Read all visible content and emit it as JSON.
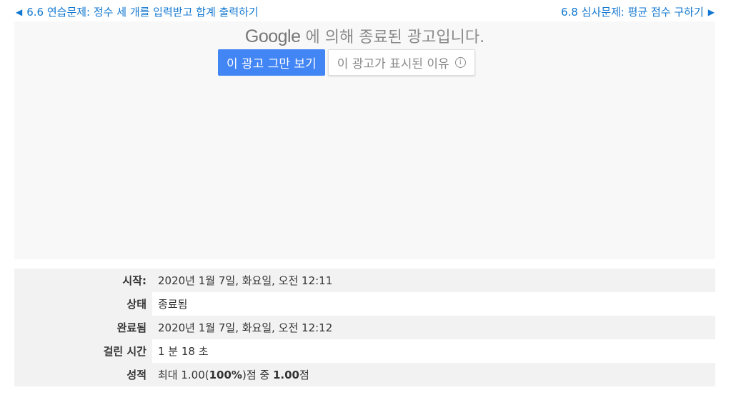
{
  "nav": {
    "prev_label": "6.6 연습문제: 정수 세 개를 입력받고 합계 출력하기",
    "next_label": "6.8 심사문제: 평균 점수 구하기",
    "prev_arrow": "◀",
    "next_arrow": "▶"
  },
  "ad": {
    "brand": "Google",
    "title_suffix": "에 의해 종료된 광고입니다.",
    "stop_label": "이 광고 그만 보기",
    "why_label": "이 광고가 표시된 이유",
    "info_glyph": "i",
    "colors": {
      "stop_button": "#4285f4",
      "background": "#f8f8f8"
    }
  },
  "summary": {
    "rows": [
      {
        "label": "시작:",
        "value": "2020년 1월 7일, 화요일, 오전 12:11"
      },
      {
        "label": "상태",
        "value": "종료됨"
      },
      {
        "label": "완료됨",
        "value": "2020년 1월 7일, 화요일, 오전 12:12"
      },
      {
        "label": "걸린 시간",
        "value": "1 분 18 초"
      }
    ],
    "grade": {
      "label": "성적",
      "prefix": "최대 1.00(",
      "percent": "100%",
      "middle": ")점 중 ",
      "score": "1.00",
      "suffix": "점"
    }
  },
  "colors": {
    "link": "#1177d1"
  }
}
